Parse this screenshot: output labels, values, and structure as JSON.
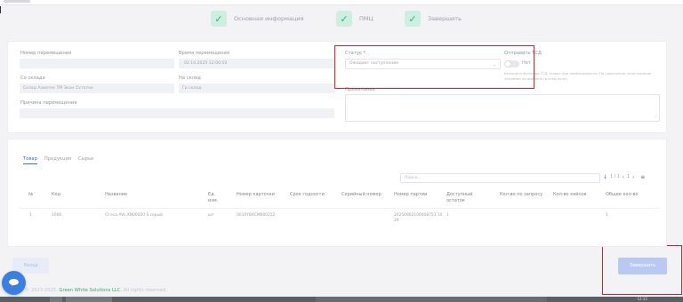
{
  "steps": [
    {
      "label": "Основная информация"
    },
    {
      "label": "ПМЦ"
    },
    {
      "label": "Завершить"
    }
  ],
  "form": {
    "transfer_number": {
      "label": "Номер перемещения",
      "value": ""
    },
    "transfer_time": {
      "label": "Время перемещения",
      "value": "02.10.2025 12:00:50"
    },
    "from_warehouse": {
      "label": "Со склада",
      "value": "Склад Азиатек ТМ Экон Остаток"
    },
    "to_warehouse": {
      "label": "На склад",
      "value": "Гр склад"
    },
    "reason": {
      "label": "Причина перемещения",
      "value": ""
    },
    "status": {
      "label": "Статус *",
      "value": "Ожидает поступления"
    },
    "send_tsd": {
      "label": "Отправить ТСД",
      "toggle_text": "Нет",
      "hint": "Включите функцию ТСД только при необходимости. По умолчанию, если никакое значение не выбрано (в этом окне)."
    },
    "note": {
      "label": "Примечание",
      "value": ""
    }
  },
  "tabs": [
    {
      "label": "Товар",
      "active": true
    },
    {
      "label": "Продукция",
      "active": false
    },
    {
      "label": "Сырье",
      "active": false
    }
  ],
  "search": {
    "placeholder": "Поиск..."
  },
  "pager": {
    "sort_icon": "arrow-down-icon",
    "range": "1 / 1",
    "current": "1"
  },
  "table": {
    "columns": [
      "№",
      "Код",
      "Название",
      "Ед. изм.",
      "Номер карточки",
      "Срок годности",
      "Серийный номер",
      "Номер партии",
      "Доступный остаток",
      "Кол-во по запросу",
      "Кол-во кейсов",
      "Общее кол-во"
    ],
    "rows": [
      [
        "1",
        "1066",
        "Ct еса AVL-XN00020 S серый",
        "шт",
        "0010YBACM000252",
        "",
        "",
        "20250902100008751 1024",
        "1",
        "",
        "",
        "1"
      ]
    ]
  },
  "buttons": {
    "back": "Назад",
    "finish": "Завершить"
  },
  "footer": {
    "prefix": "© 2023-2025,",
    "brand": "Green White Solutions LLC.",
    "suffix": "All rights reserved."
  },
  "taskbar": {
    "clock": "12:32"
  },
  "colors": {
    "accent": "#3b6fd8",
    "success": "#27b57a",
    "highlight": "#d4222b",
    "finish_button": "#b9c9f2"
  }
}
